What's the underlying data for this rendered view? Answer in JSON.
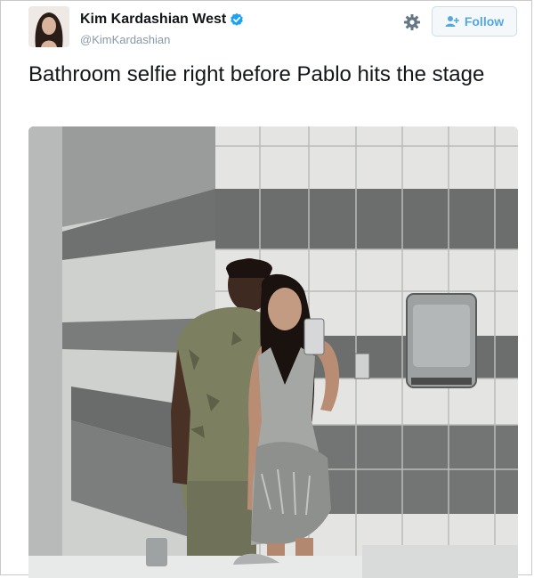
{
  "tweet": {
    "author_name": "Kim Kardashian West",
    "author_handle": "@KimKardashian",
    "text": "Bathroom selfie right before Pablo hits the stage",
    "follow_label": "Follow"
  },
  "colors": {
    "accent": "#1da1f2",
    "follow_text": "#55a8dd",
    "handle_gray": "#8899a6"
  },
  "icons": {
    "verified": "verified-badge-icon",
    "settings": "gear-icon",
    "follow": "add-user-icon"
  }
}
